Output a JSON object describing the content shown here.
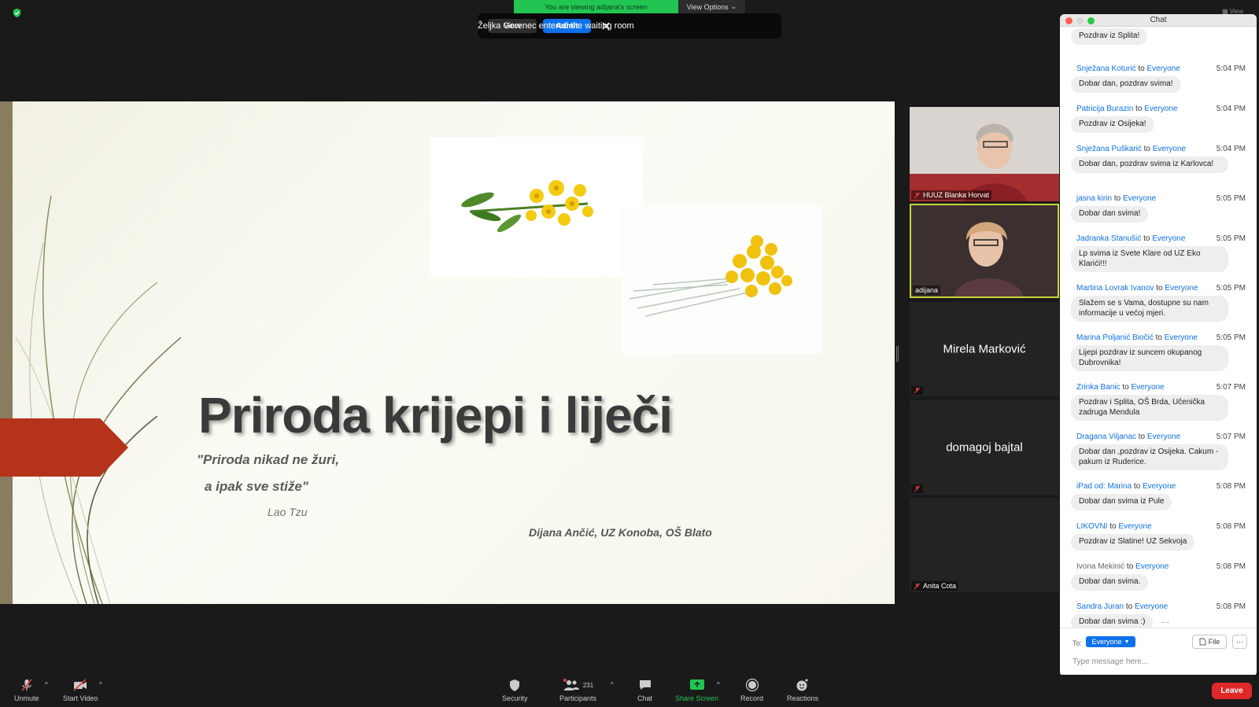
{
  "banner": {
    "viewing_text": "You are viewing adijana's screen",
    "view_options_label": "View Options"
  },
  "top_right_view": "View",
  "waiting_room": {
    "message": "Željka Gorenec entered the waiting room",
    "view_label": "View",
    "admit_label": "Admit"
  },
  "slide": {
    "title": "Priroda krijepi i liječi",
    "quote_line1": "\"Priroda nikad ne žuri,",
    "quote_line2": "a ipak sve stiže\"",
    "quote_author": "Lao Tzu",
    "byline": "Dijana Ančić, UZ Konoba, OŠ Blato"
  },
  "participants_tiles": [
    {
      "name": "HUUZ Blanka Horvat"
    },
    {
      "name": "adijana"
    },
    {
      "name": "Mirela Marković"
    },
    {
      "name": "domagoj bajtal"
    },
    {
      "name": "Anita Cota"
    }
  ],
  "chat": {
    "title": "Chat",
    "first_bubble": "Pozdrav iz Splita!",
    "to_word": "to",
    "messages": [
      {
        "sender": "Snježana Koturić",
        "to": "Everyone",
        "time": "5:04 PM",
        "text": "Dobar dan, pozdrav svima!"
      },
      {
        "sender": "Patricija Burazin",
        "to": "Everyone",
        "time": "5:04 PM",
        "text": "Pozdrav iz Osijeka!"
      },
      {
        "sender": "Snježana Puškarić",
        "to": "Everyone",
        "time": "5:04 PM",
        "text": "Dobar dan, pozdrav svima iz Karlovca!"
      },
      {
        "sender": "jasna kirin",
        "to": "Everyone",
        "time": "5:05 PM",
        "text": "Dobar dan svima!"
      },
      {
        "sender": "Jadranka Stanušić",
        "to": "Everyone",
        "time": "5:05 PM",
        "text": "Lp svima iz Svete Klare od UZ Eko Klarići!!!"
      },
      {
        "sender": "Martina Lovrak Ivanov",
        "to": "Everyone",
        "time": "5:05 PM",
        "text": "Slažem se s Vama, dostupne su nam informacije u većoj mjeri."
      },
      {
        "sender": "Marina Poljanić Biočić",
        "to": "Everyone",
        "time": "5:05 PM",
        "text": "Lijepi pozdrav iz suncem okupanog Dubrovnika!"
      },
      {
        "sender": "Zrinka Banic",
        "to": "Everyone",
        "time": "5:07 PM",
        "text": "Pozdrav i Splita, OŠ Brda, Učenička zadruga Mendula"
      },
      {
        "sender": "Dragana Viljanac",
        "to": "Everyone",
        "time": "5:07 PM",
        "text": "Dobar dan ,pozdrav iz Osijeka. Cakum -pakum iz Ruderice."
      },
      {
        "sender": "iPad od: Marina",
        "to": "Everyone",
        "time": "5:08 PM",
        "text": "Dobar dan svima iz Pule"
      },
      {
        "sender": "LIKOVNI",
        "to": "Everyone",
        "time": "5:08 PM",
        "text": "Pozdrav iz Slatine! UZ Sekvoja"
      },
      {
        "sender": "Ivona Mekinić",
        "to": "Everyone",
        "time": "5:08 PM",
        "text": "Dobar dan svima."
      },
      {
        "sender": "Sandra Juran",
        "to": "Everyone",
        "time": "5:08 PM",
        "text": "Dobar dan svima :)"
      }
    ],
    "more_dots": "···",
    "to_label": "To:",
    "recipient": "Everyone",
    "file_label": "File",
    "more_label": "···",
    "input_placeholder": "Type message here..."
  },
  "toolbar": {
    "unmute": "Unmute",
    "start_video": "Start Video",
    "security": "Security",
    "participants": "Participants",
    "participants_count": "231",
    "chat": "Chat",
    "share_screen": "Share Screen",
    "record": "Record",
    "reactions": "Reactions",
    "leave": "Leave"
  },
  "colors": {
    "accent": "#0e71eb",
    "share_green": "#23c552",
    "leave_red": "#e02828",
    "slide_arrow": "#b5331a"
  }
}
